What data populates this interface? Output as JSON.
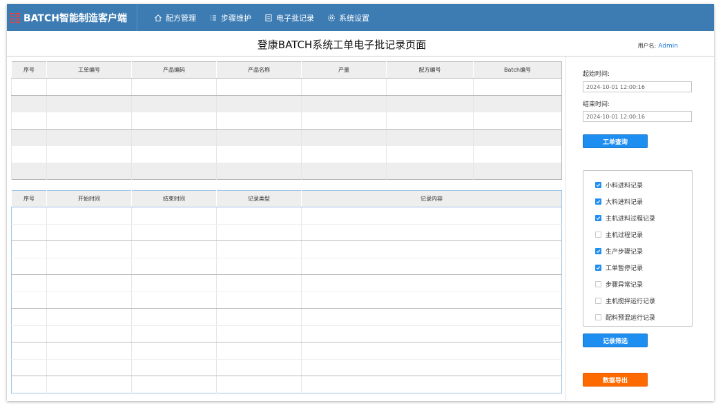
{
  "app": {
    "title": "BATCH智能制造客户端"
  },
  "nav": [
    {
      "label": "配方管理",
      "icon": "home-icon"
    },
    {
      "label": "步骤维护",
      "icon": "list-icon"
    },
    {
      "label": "电子批记录",
      "icon": "document-icon"
    },
    {
      "label": "系统设置",
      "icon": "gear-icon"
    }
  ],
  "page": {
    "title": "登康BATCH系统工单电子批记录页面"
  },
  "user": {
    "label": "用户名:",
    "name": "Admin"
  },
  "order_table": {
    "headers": [
      "序号",
      "工单编号",
      "产品编码",
      "产品名称",
      "产量",
      "配方编号",
      "Batch编号"
    ],
    "rows": []
  },
  "record_table": {
    "headers": [
      "序号",
      "开始时间",
      "结束时间",
      "记录类型",
      "记录内容"
    ],
    "rows": []
  },
  "query": {
    "start_label": "起始时间:",
    "start_value": "2024-10-01 12:00:16",
    "end_label": "结束时间:",
    "end_value": "2024-10-01 12:00:16",
    "search_button": "工单查询"
  },
  "filters": [
    {
      "label": "小料进料记录",
      "checked": true
    },
    {
      "label": "大料进料记录",
      "checked": true
    },
    {
      "label": "主机进料过程记录",
      "checked": true
    },
    {
      "label": "主机过程记录",
      "checked": false
    },
    {
      "label": "生产步骤记录",
      "checked": true
    },
    {
      "label": "工单暂停记录",
      "checked": true
    },
    {
      "label": "步骤异常记录",
      "checked": false
    },
    {
      "label": "主机搅拌运行记录",
      "checked": false
    },
    {
      "label": "配料预混运行记录",
      "checked": false
    }
  ],
  "buttons": {
    "filter": "记录筛选",
    "export": "数据导出"
  },
  "colors": {
    "topbar": "#3d7cb3",
    "primary": "#1f8ef1",
    "export": "#ff6a00",
    "accent": "#1e79d6"
  }
}
